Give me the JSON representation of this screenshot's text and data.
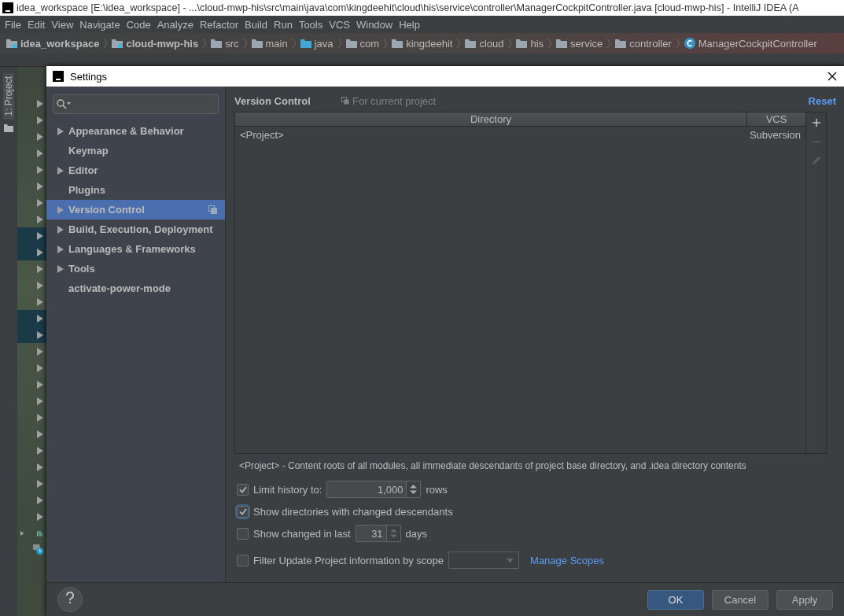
{
  "window": {
    "title": "idea_workspace [E:\\idea_workspace] - ...\\cloud-mwp-his\\src\\main\\java\\com\\kingdeehit\\cloud\\his\\service\\controller\\ManagerCockpitController.java [cloud-mwp-his] - IntelliJ IDEA (A"
  },
  "menu": [
    "File",
    "Edit",
    "View",
    "Navigate",
    "Code",
    "Analyze",
    "Refactor",
    "Build",
    "Run",
    "Tools",
    "VCS",
    "Window",
    "Help"
  ],
  "breadcrumbs": [
    {
      "label": "idea_workspace",
      "kind": "module"
    },
    {
      "label": "cloud-mwp-his",
      "kind": "module"
    },
    {
      "label": "src",
      "kind": "folder"
    },
    {
      "label": "main",
      "kind": "folder"
    },
    {
      "label": "java",
      "kind": "source"
    },
    {
      "label": "com",
      "kind": "folder"
    },
    {
      "label": "kingdeehit",
      "kind": "folder"
    },
    {
      "label": "cloud",
      "kind": "folder"
    },
    {
      "label": "his",
      "kind": "folder"
    },
    {
      "label": "service",
      "kind": "folder"
    },
    {
      "label": "controller",
      "kind": "folder"
    },
    {
      "label": "ManagerCockpitController",
      "kind": "class"
    }
  ],
  "tool_strip": {
    "label": "1: Project"
  },
  "project_tree": [
    {
      "selected": false
    },
    {
      "selected": false
    },
    {
      "selected": false
    },
    {
      "selected": false
    },
    {
      "selected": false
    },
    {
      "selected": false
    },
    {
      "selected": false
    },
    {
      "selected": false
    },
    {
      "selected": true
    },
    {
      "selected": true
    },
    {
      "selected": false
    },
    {
      "selected": false
    },
    {
      "selected": false
    },
    {
      "selected": true
    },
    {
      "selected": true
    },
    {
      "selected": false
    },
    {
      "selected": false
    },
    {
      "selected": false
    },
    {
      "selected": false
    },
    {
      "selected": false
    },
    {
      "selected": false
    },
    {
      "selected": false
    },
    {
      "selected": false
    },
    {
      "selected": false
    },
    {
      "selected": false
    },
    {
      "selected": false
    }
  ],
  "dialog": {
    "title": "Settings",
    "sidebar": {
      "items": [
        {
          "label": "Appearance & Behavior",
          "expandable": true,
          "selected": false,
          "project_level": false
        },
        {
          "label": "Keymap",
          "expandable": false,
          "selected": false,
          "project_level": false
        },
        {
          "label": "Editor",
          "expandable": true,
          "selected": false,
          "project_level": false
        },
        {
          "label": "Plugins",
          "expandable": false,
          "selected": false,
          "project_level": false
        },
        {
          "label": "Version Control",
          "expandable": true,
          "selected": true,
          "project_level": true
        },
        {
          "label": "Build, Execution, Deployment",
          "expandable": true,
          "selected": false,
          "project_level": false
        },
        {
          "label": "Languages & Frameworks",
          "expandable": true,
          "selected": false,
          "project_level": false
        },
        {
          "label": "Tools",
          "expandable": true,
          "selected": false,
          "project_level": false
        },
        {
          "label": "activate-power-mode",
          "expandable": false,
          "selected": false,
          "project_level": false
        }
      ]
    },
    "header": {
      "title": "Version Control",
      "scope": "For current project",
      "reset": "Reset"
    },
    "table": {
      "columns": [
        "Directory",
        "VCS"
      ],
      "rows": [
        [
          "<Project>",
          "Subversion"
        ]
      ],
      "toolbar": [
        {
          "kind": "add",
          "disabled": false
        },
        {
          "kind": "remove",
          "disabled": true
        },
        {
          "kind": "edit",
          "disabled": true
        }
      ]
    },
    "note": "<Project> - Content roots of all modules, all immediate descendants of project base directory, and .idea directory contents",
    "options": [
      {
        "kind": "spinner",
        "label": "Limit history to:",
        "checked": true,
        "focused": false,
        "value": "1,000",
        "unit": "rows"
      },
      {
        "kind": "check",
        "label": "Show directories with changed descendants",
        "checked": true,
        "focused": true
      },
      {
        "kind": "spinner",
        "label": "Show changed in last",
        "checked": false,
        "focused": false,
        "value": "31",
        "unit": "days"
      },
      {
        "kind": "scope",
        "label": "Filter Update Project information by scope",
        "checked": false,
        "focused": false,
        "link": "Manage Scopes"
      }
    ],
    "buttons": [
      {
        "label": "OK",
        "primary": true
      },
      {
        "label": "Cancel",
        "primary": false
      },
      {
        "label": "Apply",
        "primary": false
      }
    ]
  }
}
